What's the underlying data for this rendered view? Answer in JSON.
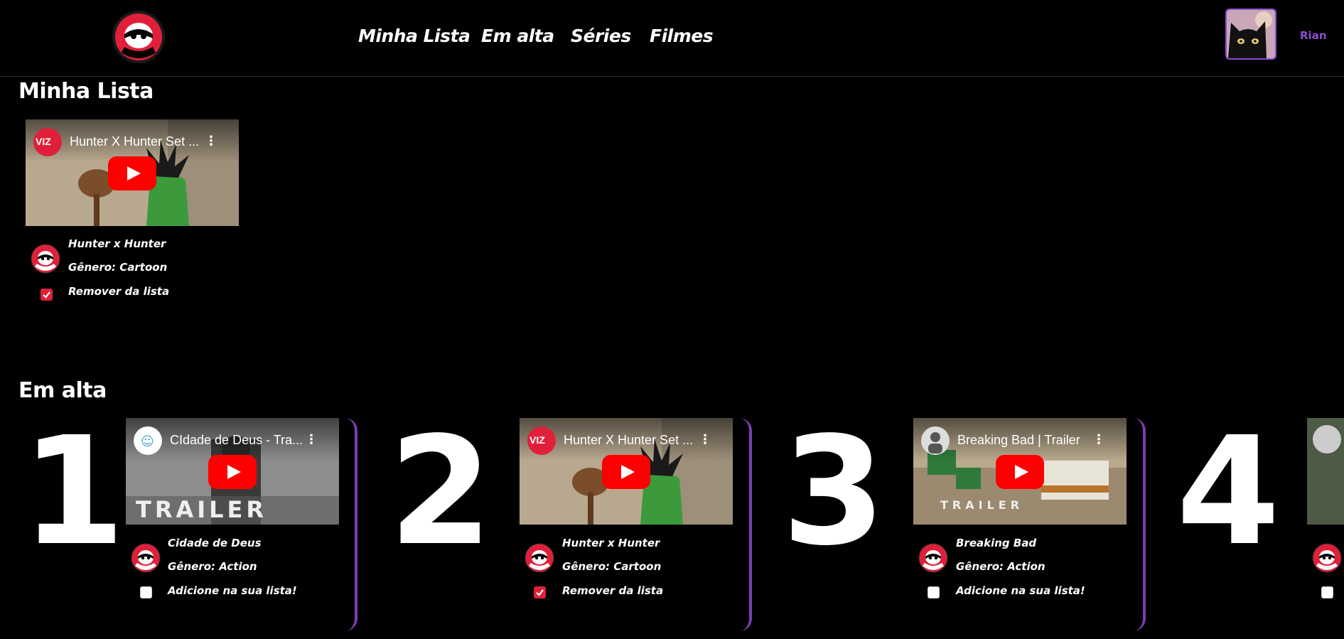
{
  "header": {
    "nav": [
      "Minha Lista",
      "Em alta",
      "Séries",
      "Filmes"
    ],
    "username": "Rian"
  },
  "my_list": {
    "title": "Minha Lista",
    "items": [
      {
        "video_title": "Hunter X Hunter Set ...",
        "channel_badge": "VIZ",
        "name": "Hunter x Hunter",
        "genre": "Gênero: Cartoon",
        "action": "Remover da lista",
        "checked": true
      }
    ]
  },
  "trending": {
    "title": "Em alta",
    "items": [
      {
        "rank": "1",
        "video_title": "CIdade de Deus - Tra...",
        "overlay_text": "TRAILER",
        "name": "Cidade de Deus",
        "genre": "Gênero: Action",
        "action": "Adicione na sua lista!",
        "checked": false
      },
      {
        "rank": "2",
        "video_title": "Hunter X Hunter Set ...",
        "channel_badge": "VIZ",
        "name": "Hunter x Hunter",
        "genre": "Gênero: Cartoon",
        "action": "Remover da lista",
        "checked": true
      },
      {
        "rank": "3",
        "video_title": "Breaking Bad | Trailer",
        "overlay_text": "TRAILER",
        "name": "Breaking Bad",
        "genre": "Gênero: Action",
        "action": "Adicione na sua lista!",
        "checked": false
      },
      {
        "rank": "4",
        "checked": false
      }
    ]
  },
  "colors": {
    "accent": "#7b3fb0",
    "brand_red": "#e0203a"
  }
}
